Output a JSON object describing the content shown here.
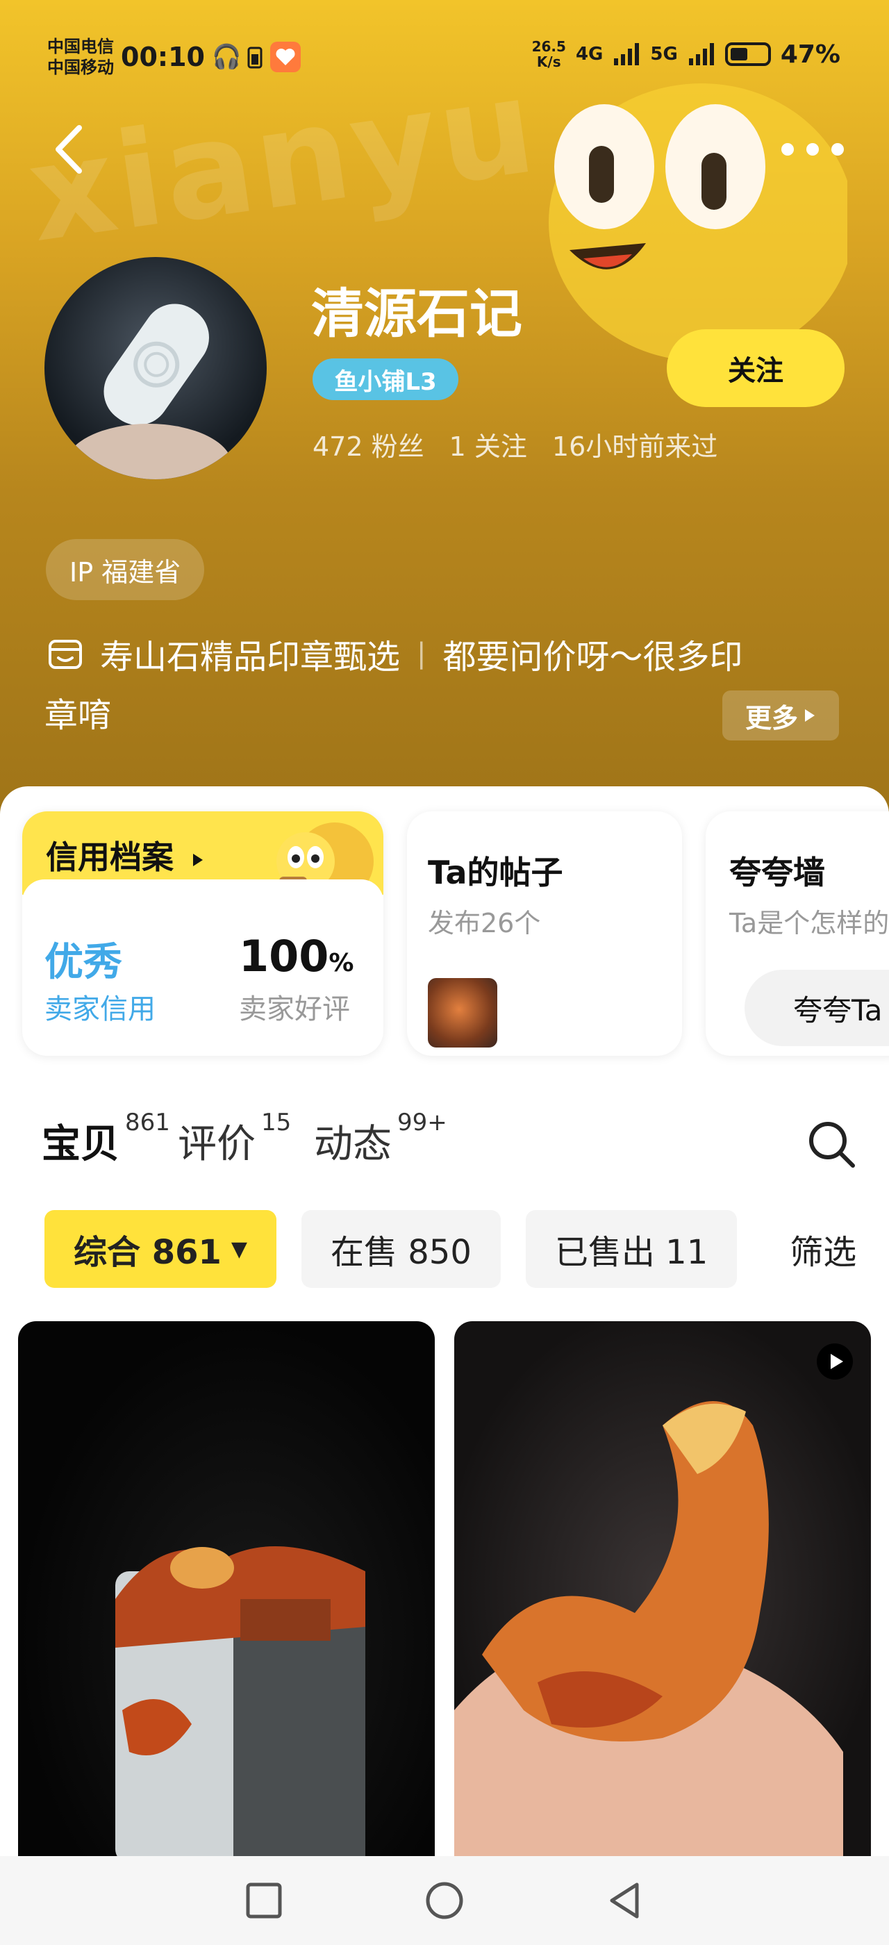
{
  "status_bar": {
    "carrier_1": "中国电信",
    "carrier_2": "中国移动",
    "time": "00:10",
    "speed_value": "26.5",
    "speed_unit": "K/s",
    "network_1": "4G",
    "network_2": "5G",
    "battery_percent": "47%",
    "battery_level": 0.47
  },
  "profile": {
    "shop_name": "清源石记",
    "level_badge": "鱼小铺L3",
    "stats": [
      "472 粉丝",
      "1 关注",
      "16小时前来过"
    ],
    "follow_label": "关注",
    "ip_location": "IP 福建省",
    "bio_part1": "寿山石精品印章甄选",
    "bio_part2": "都要问价呀～很多印",
    "bio_line2": "章唷",
    "more_label": "更多"
  },
  "cards": {
    "credit": {
      "title": "信用档案",
      "rating": "优秀",
      "rating_label": "卖家信用",
      "positive_value": "100",
      "positive_unit": "%",
      "positive_label": "卖家好评"
    },
    "posts": {
      "title": "Ta的帖子",
      "subtitle": "发布26个"
    },
    "praise": {
      "title": "夸夸墙",
      "subtitle": "Ta是个怎样的",
      "button": "夸夸Ta"
    }
  },
  "tabs": [
    {
      "label": "宝贝",
      "count": "861"
    },
    {
      "label": "评价",
      "count": "15"
    },
    {
      "label": "动态",
      "count": "99+"
    }
  ],
  "filters": {
    "chips": [
      "综合 861",
      "在售 850",
      "已售出 11"
    ],
    "filter_label": "筛选"
  },
  "colors": {
    "accent_yellow": "#ffe23b",
    "badge_blue": "#59c3e4",
    "credit_blue": "#41a9e8"
  }
}
